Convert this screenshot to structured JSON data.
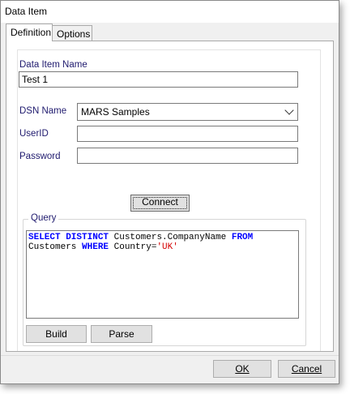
{
  "window": {
    "title": "Data Item"
  },
  "tabs": [
    {
      "label": "Definition",
      "active": true
    },
    {
      "label": "Options",
      "active": false
    }
  ],
  "form": {
    "data_item_name_label": "Data Item Name",
    "data_item_name_value": "Test 1",
    "dsn_name_label": "DSN Name",
    "dsn_name_value": "MARS Samples",
    "userid_label": "UserID",
    "userid_value": "",
    "password_label": "Password",
    "password_value": ""
  },
  "connect_button": {
    "label": "Connect"
  },
  "query": {
    "group_label": "Query",
    "tokens": {
      "t1": "SELECT DISTINCT",
      "t2": " Customers.CompanyName ",
      "t3": "FROM",
      "t4": "\nCustomers ",
      "t5": "WHERE",
      "t6": " Country=",
      "t7": "'UK'"
    },
    "build_label": "Build",
    "parse_label": "Parse"
  },
  "footer": {
    "ok_label": "OK",
    "cancel_label": "Cancel"
  },
  "colors": {
    "keyword": "#0000ff",
    "string": "#d40000",
    "label": "#1f1a6e"
  }
}
